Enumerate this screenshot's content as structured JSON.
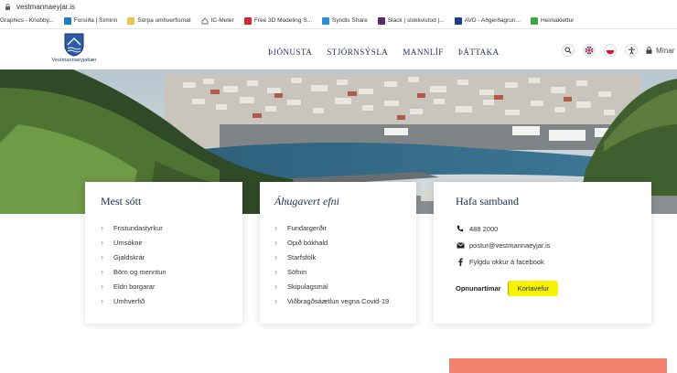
{
  "browser": {
    "url": "vestmannaeyjar.is",
    "bookmarks": [
      {
        "label": "Graphics - Knobby...",
        "icon": "bookmark-icon",
        "color": "#ffffff"
      },
      {
        "label": "Forsíða | Síminn",
        "icon": "simi-icon",
        "color": "#1a7fc1"
      },
      {
        "label": "Sorpa umhverfismat",
        "icon": "folder-icon",
        "color": "#f0c24b"
      },
      {
        "label": "IC-Meter",
        "icon": "house-icon",
        "color": "#666666"
      },
      {
        "label": "Free 3D Modeling S...",
        "icon": "gift-icon",
        "color": "#d42b2b"
      },
      {
        "label": "Syndis Share",
        "icon": "syndis-icon",
        "color": "#2a8fd8"
      },
      {
        "label": "Slack | slokkvistod |...",
        "icon": "slack-icon",
        "color": "#5b2a6e"
      },
      {
        "label": "AVD - Aðgerðagrun...",
        "icon": "avd-icon",
        "color": "#1f3a8a"
      },
      {
        "label": "Heimaklettur",
        "icon": "heimaklettur-icon",
        "color": "#3aa845"
      }
    ]
  },
  "header": {
    "logo_text": "Vestmannaeyjabær",
    "nav": [
      "ÞJÓNUSTA",
      "STJÓRNSÝSLA",
      "MANNLÍF",
      "ÞÁTTAKA"
    ],
    "login_label": "Mínar s"
  },
  "cards": {
    "popular": {
      "title": "Mest sótt",
      "items": [
        "Fristundastyrkur",
        "Umsóknir",
        "Gjaldskrár",
        "Börn og menntun",
        "Eldri borgarar",
        "Umhverfið"
      ]
    },
    "interesting": {
      "title": "Áhugavert efni",
      "items": [
        "Fundargerðir",
        "Opið bókhald",
        "Starfsfólk",
        "Söfnin",
        "Skipulagsmál",
        "Viðbragðsáætlun vegna Covid-19"
      ]
    },
    "contact": {
      "title": "Hafa samband",
      "phone": "488 2000",
      "email": "postur@vestmannaeyjar.is",
      "facebook": "Fylgdu okkur á facebook",
      "hours_label": "Opnunartímar",
      "map_label": "Kortavefur"
    }
  },
  "colors": {
    "nav_text": "#1e2d4f",
    "highlight": "#f8f200",
    "accent_block": "#f2826f"
  }
}
